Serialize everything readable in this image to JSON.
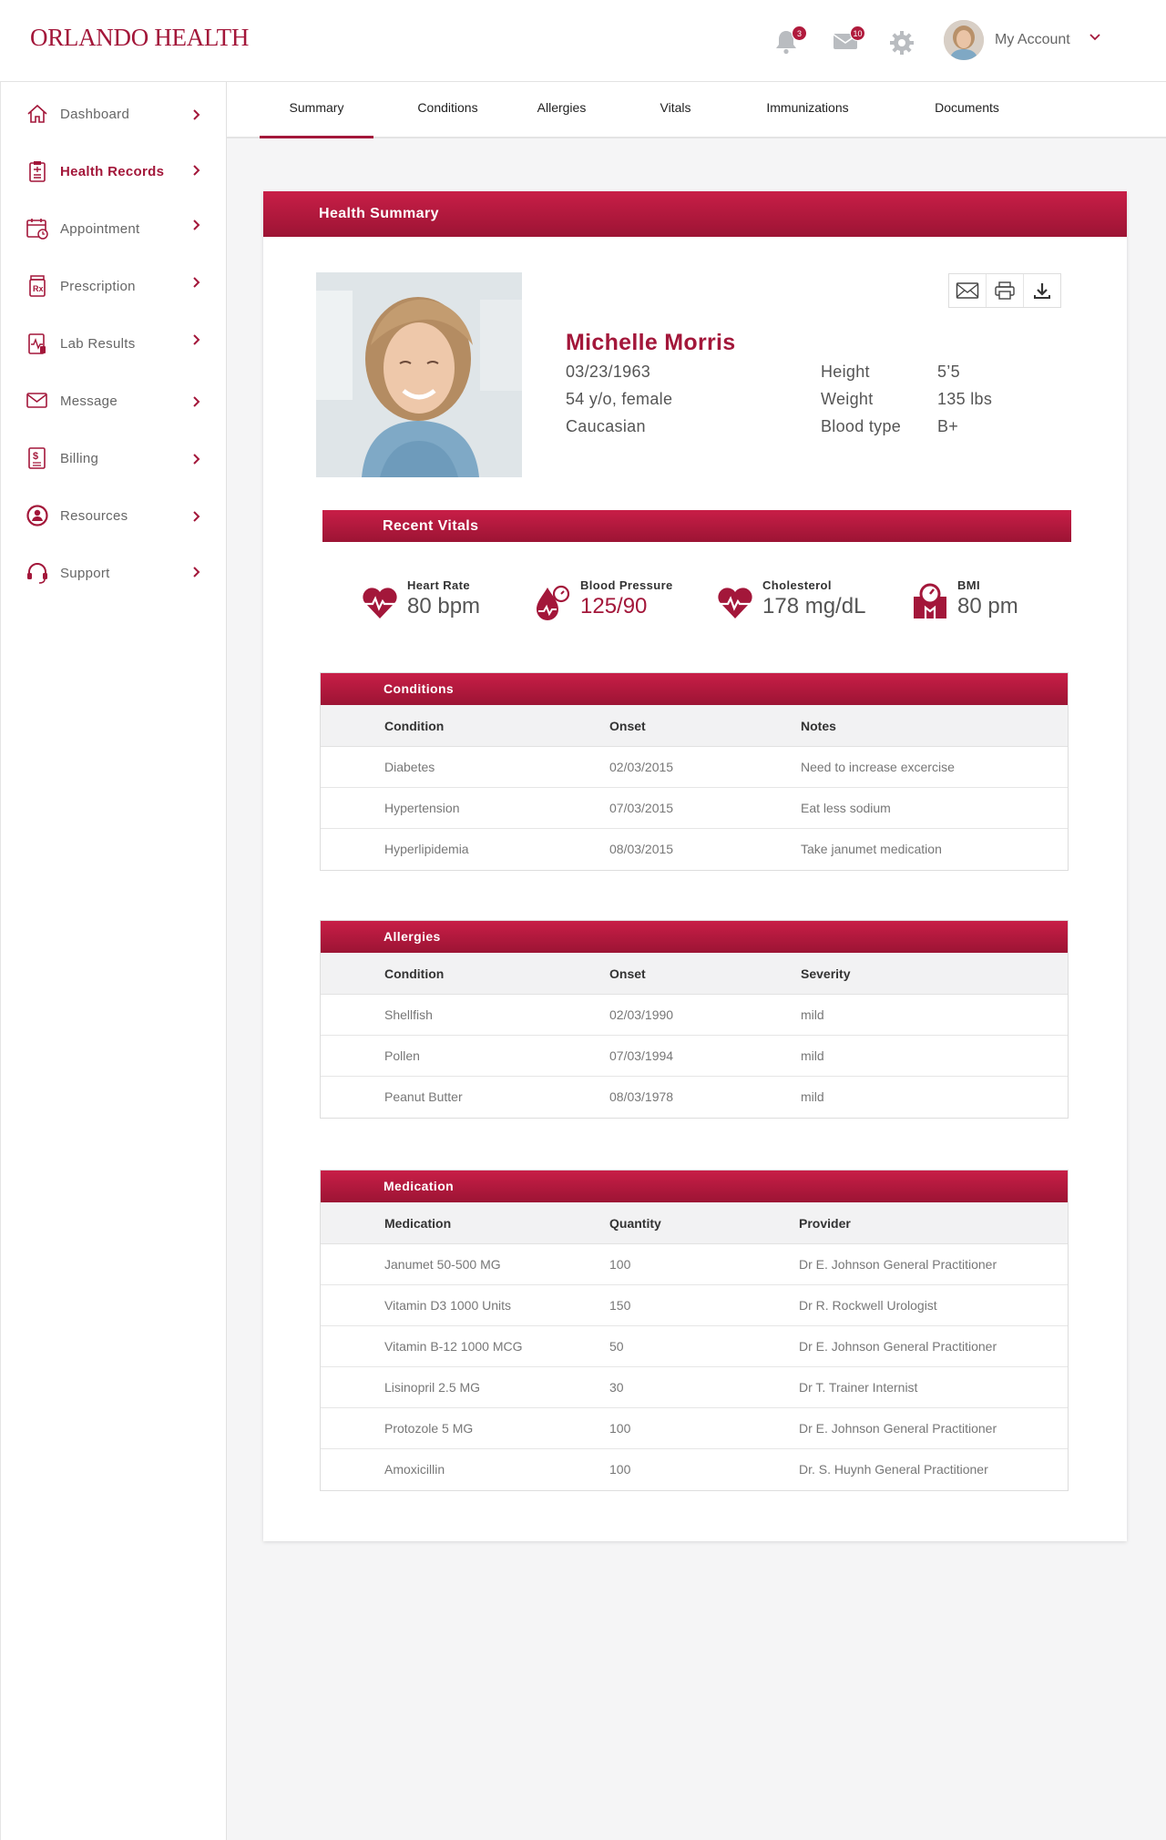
{
  "brand": {
    "logo_text": "ORLANDO HEALTH"
  },
  "header": {
    "notifications_count": "3",
    "messages_count": "10",
    "account_label": "My Account"
  },
  "sidebar": {
    "items": [
      {
        "label": "Dashboard",
        "icon": "home-icon"
      },
      {
        "label": "Health Records",
        "icon": "clipboard-icon"
      },
      {
        "label": "Appointment",
        "icon": "calendar-clock-icon"
      },
      {
        "label": "Prescription",
        "icon": "prescription-icon"
      },
      {
        "label": "Lab Results",
        "icon": "lab-report-icon"
      },
      {
        "label": "Message",
        "icon": "envelope-icon"
      },
      {
        "label": "Billing",
        "icon": "bill-dollar-icon"
      },
      {
        "label": "Resources",
        "icon": "resources-icon"
      },
      {
        "label": "Support",
        "icon": "headset-icon"
      }
    ],
    "active": "Health Records"
  },
  "tabs": [
    {
      "label": "Summary"
    },
    {
      "label": "Conditions"
    },
    {
      "label": "Allergies"
    },
    {
      "label": "Vitals"
    },
    {
      "label": "Immunizations"
    },
    {
      "label": "Documents"
    }
  ],
  "summary": {
    "title": "Health Summary",
    "patient": {
      "name": "Michelle Morris",
      "dob": "03/23/1963",
      "age_sex": "54 y/o, female",
      "ethnicity": "Caucasian",
      "height_label": "Height",
      "height": "5’5",
      "weight_label": "Weight",
      "weight": "135 lbs",
      "blood_type_label": "Blood type",
      "blood_type": "B+"
    }
  },
  "vitals": {
    "title": "Recent Vitals",
    "items": [
      {
        "label": "Heart Rate",
        "value": "80 bpm",
        "icon": "heart-pulse-icon"
      },
      {
        "label": "Blood Pressure",
        "value": "125/90",
        "icon": "blood-drop-gauge-icon"
      },
      {
        "label": "Cholesterol",
        "value": "178 mg/dL",
        "icon": "heart-pulse-icon"
      },
      {
        "label": "BMI",
        "value": "80 pm",
        "icon": "scale-body-icon"
      }
    ]
  },
  "conditions": {
    "title": "Conditions",
    "headers": [
      "Condition",
      "Onset",
      "Notes"
    ],
    "rows": [
      [
        "Diabetes",
        "02/03/2015",
        "Need to increase excercise"
      ],
      [
        "Hypertension",
        "07/03/2015",
        "Eat less sodium"
      ],
      [
        "Hyperlipidemia",
        "08/03/2015",
        "Take janumet medication"
      ]
    ]
  },
  "allergies": {
    "title": "Allergies",
    "headers": [
      "Condition",
      "Onset",
      "Severity"
    ],
    "rows": [
      [
        "Shellfish",
        "02/03/1990",
        "mild"
      ],
      [
        "Pollen",
        "07/03/1994",
        "mild"
      ],
      [
        "Peanut Butter",
        "08/03/1978",
        "mild"
      ]
    ]
  },
  "medication": {
    "title": "Medication",
    "headers": [
      "Medication",
      "Quantity",
      "Provider"
    ],
    "rows": [
      [
        "Janumet 50-500 MG",
        "100",
        "Dr E. Johnson General Practitioner"
      ],
      [
        "Vitamin D3 1000 Units",
        "150",
        "Dr R. Rockwell Urologist"
      ],
      [
        "Vitamin B-12 1000 MCG",
        "50",
        "Dr E. Johnson General Practitioner"
      ],
      [
        "Lisinopril 2.5 MG",
        "30",
        "Dr T. Trainer Internist"
      ],
      [
        "Protozole 5 MG",
        "100",
        "Dr E. Johnson General Practitioner"
      ],
      [
        "Amoxicillin",
        "100",
        "Dr. S. Huynh General Practitioner"
      ]
    ]
  },
  "colors": {
    "brand": "#a3173a",
    "bar_top": "#c81e47",
    "bar_bottom": "#9c1434"
  }
}
